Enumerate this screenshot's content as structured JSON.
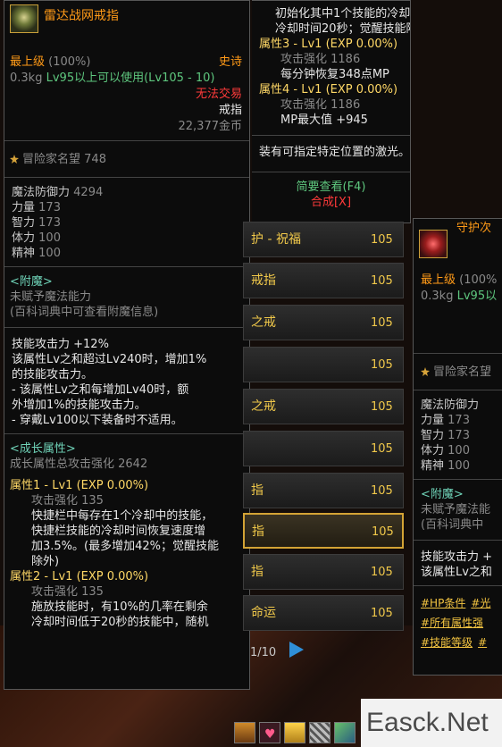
{
  "left": {
    "title": "雷达战网戒指",
    "rarity": "最上级",
    "rarity_pct": "(100%)",
    "grade": "史诗",
    "weight": "0.3kg",
    "level_req": "Lv95以上可以使用(Lv105 - 10)",
    "trade": "无法交易",
    "type": "戒指",
    "price": "22,377金币",
    "reputation_label": "冒险家名望",
    "reputation_value": "748",
    "stats": [
      {
        "name": "魔法防御力",
        "value": "4294"
      },
      {
        "name": "力量",
        "value": "173"
      },
      {
        "name": "智力",
        "value": "173"
      },
      {
        "name": "体力",
        "value": "100"
      },
      {
        "name": "精神",
        "value": "100"
      }
    ],
    "enchant_title": "<附魔>",
    "enchant_line1": "未赋予魔法能力",
    "enchant_line2": "(百科词典中可查看附魔信息)",
    "skill_lines": [
      "技能攻击力 +12%",
      "该属性Lv之和超过Lv240时，增加1%",
      "的技能攻击力。",
      "- 该属性Lv之和每增加Lv40时，额",
      "外增加1%的技能攻击力。",
      "- 穿戴Lv100以下装备时不适用。"
    ],
    "growth_title": "<成长属性>",
    "growth_total": "成长属性总攻击强化 2642",
    "attr1_title": "属性1 - Lv1 (EXP 0.00%)",
    "attr1_atk": "攻击强化 135",
    "attr1_desc": [
      "快捷栏中每存在1个冷却中的技能，",
      "快捷栏技能的冷却时间恢复速度增",
      "加3.5%。(最多增加42%；觉醒技能",
      "除外)"
    ],
    "attr2_title": "属性2 - Lv1 (EXP 0.00%)",
    "attr2_atk": "攻击强化 135",
    "attr2_desc": [
      "施放技能时，有10%的几率在剩余",
      "冷却时间低于20秒的技能中，随机"
    ]
  },
  "mid": {
    "top_lines": [
      "初始化其中1个技能的冷却时间。(",
      "冷却时间20秒；觉醒技能除外)"
    ],
    "attr3_title": "属性3 - Lv1 (EXP 0.00%)",
    "attr3_atk": "攻击强化 1186",
    "attr3_desc": "每分钟恢复348点MP",
    "attr4_title": "属性4 - Lv1 (EXP 0.00%)",
    "attr4_atk": "攻击强化 1186",
    "attr4_desc": "MP最大值 +945",
    "laser": "装有可指定特定位置的激光。",
    "brief_view": "简要查看(F4)",
    "synth": "合成[X]"
  },
  "list": {
    "items": [
      {
        "name": "护 - 祝福",
        "level": "105"
      },
      {
        "name": "戒指",
        "level": "105"
      },
      {
        "name": "之戒",
        "level": "105"
      },
      {
        "name": "",
        "level": "105"
      },
      {
        "name": "之戒",
        "level": "105"
      },
      {
        "name": "",
        "level": "105"
      },
      {
        "name": "指",
        "level": "105"
      },
      {
        "name": "指",
        "level": "105"
      },
      {
        "name": "指",
        "level": "105"
      },
      {
        "name": "命运",
        "level": "105"
      }
    ],
    "page": "1/10"
  },
  "right": {
    "title": "守护次",
    "rarity": "最上级",
    "rarity_pct": "(100%",
    "weight": "0.3kg",
    "level_req": "Lv95以",
    "reputation_label": "冒险家名望",
    "stats": [
      {
        "name": "魔法防御力",
        "value": "173"
      },
      {
        "name": "力量",
        "value": "173"
      },
      {
        "name": "智力",
        "value": "173"
      },
      {
        "name": "体力",
        "value": "100"
      },
      {
        "name": "精神",
        "value": "100"
      }
    ],
    "enchant_title": "<附魔>",
    "enchant_line1": "未赋予魔法能",
    "enchant_line2": "(百科词典中",
    "skill_line1": "技能攻击力 +",
    "skill_line2": "该属性Lv之和",
    "tags": [
      "#HP条件",
      "#光",
      "#所有属性强",
      "#技能等级",
      "#"
    ]
  },
  "watermark": "Easck.Net"
}
